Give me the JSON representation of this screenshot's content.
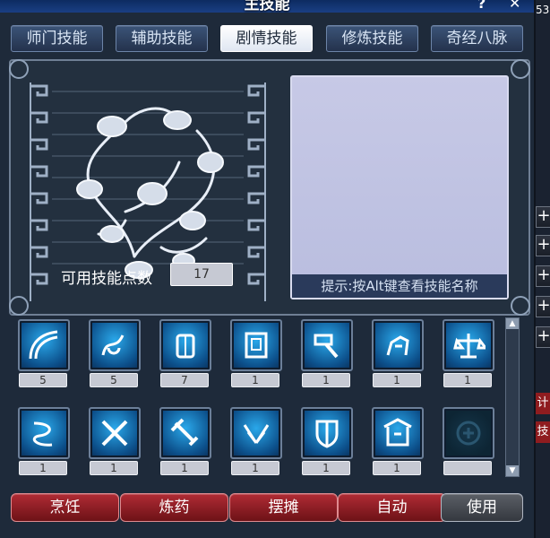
{
  "window": {
    "title": "主技能",
    "help_label": "?",
    "close_label": "✕"
  },
  "tabs": [
    {
      "label": "师门技能",
      "active": false
    },
    {
      "label": "辅助技能",
      "active": false
    },
    {
      "label": "剧情技能",
      "active": true
    },
    {
      "label": "修炼技能",
      "active": false
    },
    {
      "label": "奇经八脉",
      "active": false
    }
  ],
  "skill_points": {
    "label": "可用技能点数",
    "value": "17"
  },
  "hint": {
    "text": "提示:按Alt键查看技能名称"
  },
  "skills_row1": [
    {
      "icon": "curve-icon",
      "level": "5"
    },
    {
      "icon": "scroll-spiral-icon",
      "level": "5"
    },
    {
      "icon": "lantern-icon",
      "level": "7"
    },
    {
      "icon": "scroll-document-icon",
      "level": "1"
    },
    {
      "icon": "hammer-icon",
      "level": "1"
    },
    {
      "icon": "horse-icon",
      "level": "1"
    },
    {
      "icon": "weighing-scale-icon",
      "level": "1"
    }
  ],
  "skills_row2": [
    {
      "icon": "serpent-icon",
      "level": "1"
    },
    {
      "icon": "crossed-blades-icon",
      "level": "1"
    },
    {
      "icon": "sword-icon",
      "level": "1"
    },
    {
      "icon": "wings-icon",
      "level": "1"
    },
    {
      "icon": "shield-banner-icon",
      "level": "1"
    },
    {
      "icon": "pavilion-icon",
      "level": "1"
    },
    {
      "icon": "empty-slot-icon",
      "level": ""
    }
  ],
  "actions": [
    {
      "label": "烹饪",
      "style": "red"
    },
    {
      "label": "炼药",
      "style": "red"
    },
    {
      "label": "摆摊",
      "style": "red"
    },
    {
      "label": "自动",
      "style": "red"
    },
    {
      "label": "使用",
      "style": "gray"
    }
  ],
  "side_panel": {
    "top_number": "53",
    "red_text_1": "计",
    "red_text_2": "技能"
  }
}
